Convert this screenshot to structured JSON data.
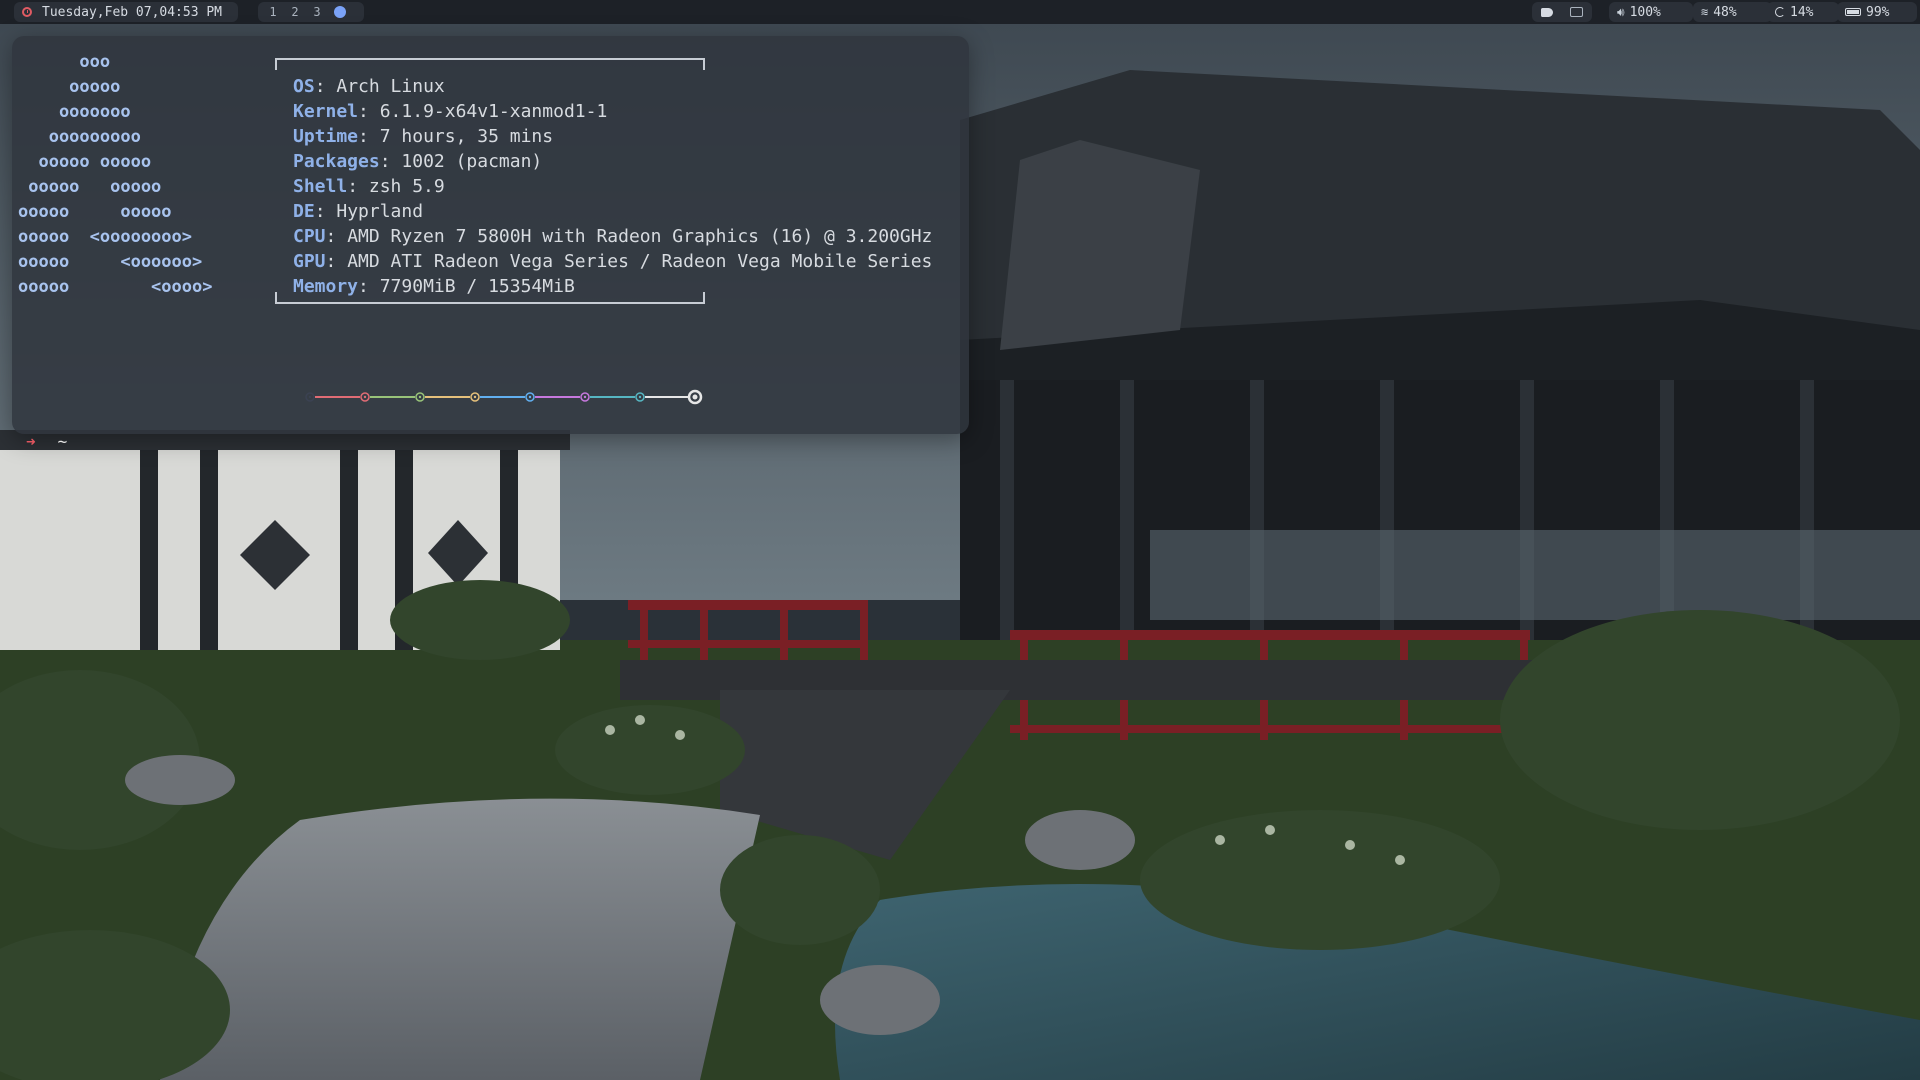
{
  "topbar": {
    "clock": "Tuesday,Feb 07,04:53 PM",
    "workspaces": [
      "1",
      "2",
      "3"
    ],
    "volume": "100%",
    "wifi": "48%",
    "cpu": "14%",
    "battery": "99%",
    "icons": {
      "clock": "clock-icon",
      "volume": "speaker-icon",
      "wifi": "wifi-icon",
      "cpu": "cpu-icon",
      "battery": "battery-icon"
    }
  },
  "terminal": {
    "logo": "      ooo\n     ooooo\n    ooooooo\n   ooooooooo\n  ooooo ooooo\n ooooo   ooooo\nooooo     ooooo\nooooo  <oooooooo>\nooooo     <oooooo>\nooooo        <oooo>",
    "info": [
      {
        "key": "OS",
        "value": "Arch Linux"
      },
      {
        "key": "Kernel",
        "value": "6.1.9-x64v1-xanmod1-1"
      },
      {
        "key": "Uptime",
        "value": "7 hours, 35 mins"
      },
      {
        "key": "Packages",
        "value": "1002 (pacman)"
      },
      {
        "key": "Shell",
        "value": "zsh 5.9"
      },
      {
        "key": "DE",
        "value": "Hyprland"
      },
      {
        "key": "CPU",
        "value": "AMD Ryzen 7 5800H with Radeon Graphics (16) @ 3.200GHz"
      },
      {
        "key": "GPU",
        "value": "AMD ATI Radeon Vega Series / Radeon Vega Mobile Series"
      },
      {
        "key": "Memory",
        "value": "7790MiB / 15354MiB"
      }
    ],
    "palette": [
      "#3b4252",
      "#e06c75",
      "#98c379",
      "#e5c07b",
      "#61afef",
      "#c678dd",
      "#56b6c2",
      "#e6e6e6"
    ],
    "prompt": {
      "symbol": "➜",
      "cwd": "~",
      "accent": "#e0555e"
    }
  }
}
